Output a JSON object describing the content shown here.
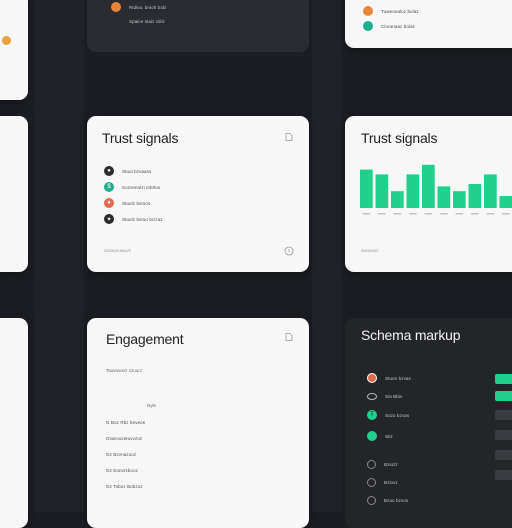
{
  "colors": {
    "background": "#1b1d22",
    "card_light": "#f7f7f8",
    "card_dark": "#2a2c31",
    "accent_green": "#1fd18c",
    "orange": "#e8843a",
    "teal": "#1fae8a",
    "red": "#e46a4f",
    "dark_dot": "#2b2b2b"
  },
  "top_center": {
    "rows": [
      "Ridiva, bnioh bolz",
      "Spaice Isaiz ziiliz"
    ]
  },
  "top_right": {
    "rows": [
      "Tuweonaloz bolaz",
      "Cloranaaz bolaz"
    ]
  },
  "trust_list": {
    "title": "Trust signals",
    "rows": [
      "Stuol bzvaass",
      "Sozvenolzi mbrlos",
      "Stuolz bvtoos",
      "Stuolz bvtoo bizzaz"
    ],
    "footer": "Sorasnowuvz"
  },
  "trust_chart": {
    "title": "Trust signals",
    "footer": "Sorawnz"
  },
  "chart_data": {
    "type": "bar",
    "title": "Trust signals",
    "categories": [
      "",
      "",
      "",
      "",
      "",
      "",
      "",
      "",
      "",
      ""
    ],
    "values": [
      8,
      7,
      3.5,
      7,
      9,
      4.5,
      3.5,
      5,
      7,
      2.5
    ],
    "ylim": [
      0,
      10
    ],
    "grid": false,
    "legend": "none"
  },
  "engagement": {
    "title": "Engagement",
    "subtitle": "Tauvnoovz zzuorz",
    "mid_label": "Nyle",
    "rows": [
      "G Boz Rbz bnveos",
      "Gvarouzetuvvzoz",
      "Gz Bzvnazooz",
      "Gz Eonvrzbooz",
      "Gz Toboz Bobzoz"
    ]
  },
  "schema": {
    "title": "Schema markup",
    "rows": [
      "Stuon bzvas",
      "Sia Bbiv",
      "Sozo bzvas",
      "Stiz",
      "Bziozz",
      "Bziovz",
      "Bzuo bzvos"
    ]
  }
}
